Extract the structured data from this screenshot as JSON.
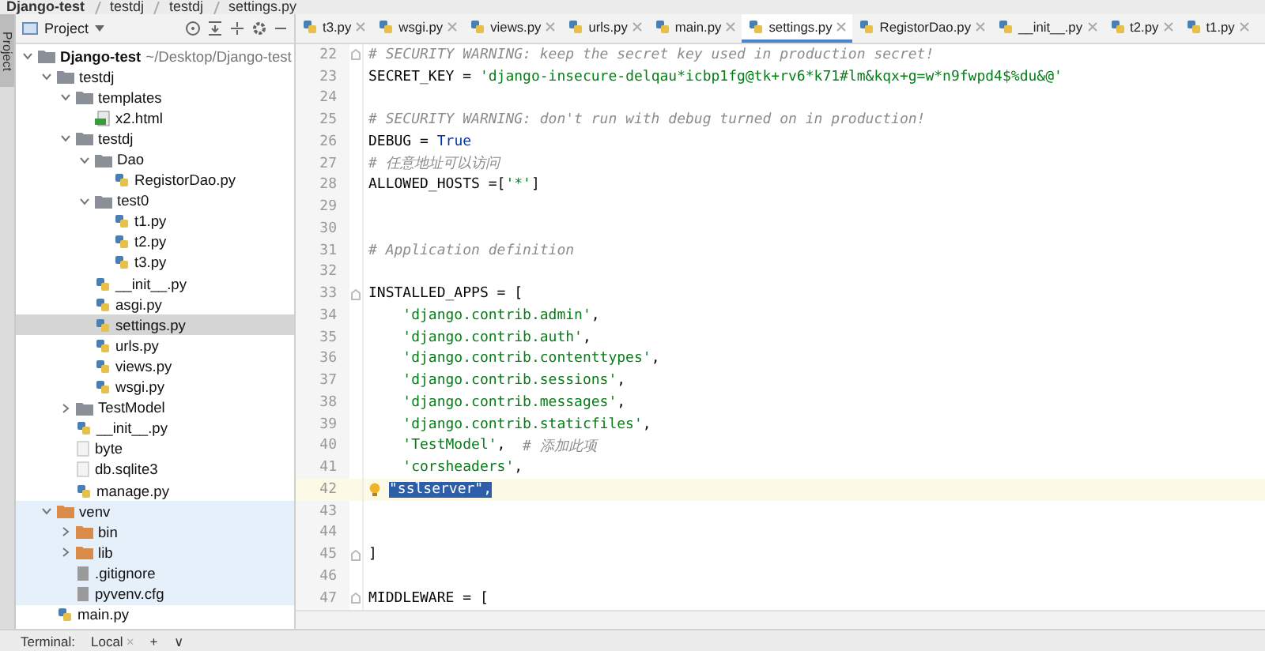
{
  "breadcrumb": [
    "Django-test",
    "testdj",
    "testdj",
    "settings.py"
  ],
  "side_strip": {
    "label": "Project"
  },
  "project_panel": {
    "title": "Project"
  },
  "tree": [
    {
      "label": "Django-test",
      "kind": "project",
      "hint": "~/Desktop/Django-test",
      "expanded": true,
      "selected": false,
      "excluded": false,
      "children": [
        {
          "label": "testdj",
          "kind": "folder",
          "expanded": true,
          "selected": false,
          "excluded": false,
          "children": [
            {
              "label": "templates",
              "kind": "folder",
              "expanded": true,
              "selected": false,
              "excluded": false,
              "children": [
                {
                  "label": "x2.html",
                  "kind": "html",
                  "selected": false,
                  "excluded": false
                }
              ]
            },
            {
              "label": "testdj",
              "kind": "folder",
              "expanded": true,
              "selected": false,
              "excluded": false,
              "children": [
                {
                  "label": "Dao",
                  "kind": "folder",
                  "expanded": true,
                  "selected": false,
                  "excluded": false,
                  "children": [
                    {
                      "label": "RegistorDao.py",
                      "kind": "python",
                      "selected": false,
                      "excluded": false
                    }
                  ]
                },
                {
                  "label": "test0",
                  "kind": "folder",
                  "expanded": true,
                  "selected": false,
                  "excluded": false,
                  "children": [
                    {
                      "label": "t1.py",
                      "kind": "python",
                      "selected": false,
                      "excluded": false
                    },
                    {
                      "label": "t2.py",
                      "kind": "python",
                      "selected": false,
                      "excluded": false
                    },
                    {
                      "label": "t3.py",
                      "kind": "python",
                      "selected": false,
                      "excluded": false
                    }
                  ]
                },
                {
                  "label": "__init__.py",
                  "kind": "python",
                  "selected": false,
                  "excluded": false
                },
                {
                  "label": "asgi.py",
                  "kind": "python",
                  "selected": false,
                  "excluded": false
                },
                {
                  "label": "settings.py",
                  "kind": "python",
                  "selected": true,
                  "excluded": false
                },
                {
                  "label": "urls.py",
                  "kind": "python",
                  "selected": false,
                  "excluded": false
                },
                {
                  "label": "views.py",
                  "kind": "python",
                  "selected": false,
                  "excluded": false
                },
                {
                  "label": "wsgi.py",
                  "kind": "python",
                  "selected": false,
                  "excluded": false
                }
              ]
            },
            {
              "label": "TestModel",
              "kind": "folder",
              "expanded": false,
              "selected": false,
              "excluded": false
            },
            {
              "label": "__init__.py",
              "kind": "python",
              "selected": false,
              "excluded": false
            },
            {
              "label": "byte",
              "kind": "text",
              "selected": false,
              "excluded": false
            },
            {
              "label": "db.sqlite3",
              "kind": "text",
              "selected": false,
              "excluded": false
            },
            {
              "label": "manage.py",
              "kind": "python",
              "selected": false,
              "excluded": false
            }
          ]
        },
        {
          "label": "venv",
          "kind": "folder",
          "expanded": true,
          "selected": false,
          "excluded": true,
          "children": [
            {
              "label": "bin",
              "kind": "folder",
              "expanded": false,
              "selected": false,
              "excluded": true
            },
            {
              "label": "lib",
              "kind": "folder",
              "expanded": false,
              "selected": false,
              "excluded": true
            },
            {
              "label": ".gitignore",
              "kind": "config",
              "selected": false,
              "excluded": true
            },
            {
              "label": "pyvenv.cfg",
              "kind": "config",
              "selected": false,
              "excluded": true
            }
          ]
        },
        {
          "label": "main.py",
          "kind": "python",
          "selected": false,
          "excluded": false
        }
      ]
    }
  ],
  "tabs": [
    {
      "label": "t3.py",
      "selected": false
    },
    {
      "label": "wsgi.py",
      "selected": false
    },
    {
      "label": "views.py",
      "selected": false
    },
    {
      "label": "urls.py",
      "selected": false
    },
    {
      "label": "main.py",
      "selected": false
    },
    {
      "label": "settings.py",
      "selected": true
    },
    {
      "label": "RegistorDao.py",
      "selected": false
    },
    {
      "label": "__init__.py",
      "selected": false
    },
    {
      "label": "t2.py",
      "selected": false
    },
    {
      "label": "t1.py",
      "selected": false
    }
  ],
  "code_lines": [
    {
      "number": "22",
      "fold": true,
      "current": false,
      "tokens": [
        {
          "kind": "comment",
          "text": "# SECURITY WARNING: keep the secret key used in production secret!"
        }
      ]
    },
    {
      "number": "23",
      "current": false,
      "tokens": [
        {
          "kind": "plain",
          "text": "SECRET_KEY = "
        },
        {
          "kind": "string",
          "text": "'django-insecure-delqau*icbp1fg@tk+rv6*k71#lm&kqx+g=w*n9fwpd4$%du&@'"
        }
      ]
    },
    {
      "number": "24",
      "current": false
    },
    {
      "number": "25",
      "current": false,
      "tokens": [
        {
          "kind": "comment",
          "text": "# SECURITY WARNING: don't run with debug turned on in production!"
        }
      ]
    },
    {
      "number": "26",
      "current": false,
      "tokens": [
        {
          "kind": "plain",
          "text": "DEBUG = "
        },
        {
          "kind": "keyword",
          "text": "True"
        }
      ]
    },
    {
      "number": "27",
      "current": false,
      "tokens": [
        {
          "kind": "comment",
          "text": "# 任意地址可以访问"
        }
      ]
    },
    {
      "number": "28",
      "current": false,
      "tokens": [
        {
          "kind": "plain",
          "text": "ALLOWED_HOSTS =["
        },
        {
          "kind": "string",
          "text": "'*'"
        },
        {
          "kind": "plain",
          "text": "]"
        }
      ]
    },
    {
      "number": "29",
      "current": false
    },
    {
      "number": "30",
      "current": false
    },
    {
      "number": "31",
      "current": false,
      "tokens": [
        {
          "kind": "comment",
          "text": "# Application definition"
        }
      ]
    },
    {
      "number": "32",
      "current": false
    },
    {
      "number": "33",
      "fold": true,
      "current": false,
      "tokens": [
        {
          "kind": "plain",
          "text": "INSTALLED_APPS = ["
        }
      ]
    },
    {
      "number": "34",
      "current": false,
      "tokens": [
        {
          "kind": "string",
          "text": "    'django.contrib.admin'"
        },
        {
          "kind": "plain",
          "text": ","
        }
      ]
    },
    {
      "number": "35",
      "current": false,
      "tokens": [
        {
          "kind": "string",
          "text": "    'django.contrib.auth'"
        },
        {
          "kind": "plain",
          "text": ","
        }
      ]
    },
    {
      "number": "36",
      "current": false,
      "tokens": [
        {
          "kind": "string",
          "text": "    'django.contrib.contenttypes'"
        },
        {
          "kind": "plain",
          "text": ","
        }
      ]
    },
    {
      "number": "37",
      "current": false,
      "tokens": [
        {
          "kind": "string",
          "text": "    'django.contrib.sessions'"
        },
        {
          "kind": "plain",
          "text": ","
        }
      ]
    },
    {
      "number": "38",
      "current": false,
      "tokens": [
        {
          "kind": "string",
          "text": "    'django.contrib.messages'"
        },
        {
          "kind": "plain",
          "text": ","
        }
      ]
    },
    {
      "number": "39",
      "current": false,
      "tokens": [
        {
          "kind": "string",
          "text": "    'django.contrib.staticfiles'"
        },
        {
          "kind": "plain",
          "text": ","
        }
      ]
    },
    {
      "number": "40",
      "current": false,
      "tokens": [
        {
          "kind": "string",
          "text": "    'TestModel'"
        },
        {
          "kind": "plain",
          "text": ",  "
        },
        {
          "kind": "comment",
          "text": "# 添加此项"
        }
      ]
    },
    {
      "number": "41",
      "current": false,
      "tokens": [
        {
          "kind": "string",
          "text": "    'corsheaders'"
        },
        {
          "kind": "plain",
          "text": ","
        }
      ]
    },
    {
      "number": "42",
      "current": true,
      "bulb": true,
      "tokens": [
        {
          "kind": "selected",
          "text": "\"sslserver\","
        }
      ]
    },
    {
      "number": "43",
      "current": false
    },
    {
      "number": "44",
      "current": false
    },
    {
      "number": "45",
      "fold": true,
      "current": false,
      "tokens": [
        {
          "kind": "plain",
          "text": "]"
        }
      ]
    },
    {
      "number": "46",
      "current": false
    },
    {
      "number": "47",
      "fold": true,
      "current": false,
      "tokens": [
        {
          "kind": "plain",
          "text": "MIDDLEWARE = ["
        }
      ]
    }
  ],
  "bottom_bar": {
    "label": "Terminal:",
    "tab": "Local",
    "close": "×",
    "add": "+",
    "menu": "∨"
  }
}
